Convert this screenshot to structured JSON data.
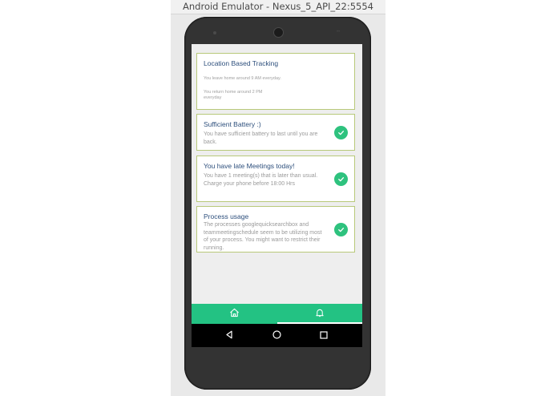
{
  "window": {
    "title": "Android Emulator - Nexus_5_API_22:5554"
  },
  "cards": [
    {
      "title": "Location Based Tracking",
      "lines": [
        "You leave home around 9 AM everyday.",
        "You return home around 2 PM everyday"
      ],
      "checked": false
    },
    {
      "title": "Sufficient Battery :)",
      "text": "You have sufficient battery to last until you are back.",
      "checked": true
    },
    {
      "title": "You have late Meetings today!",
      "text": "You have 1 meeting(s) that is later than usual. Charge your phone before 18:00 Hrs",
      "checked": true
    },
    {
      "title": "Process usage",
      "text": "The processes googlequicksearchbox and teammeetingschedule seem to be utilizing most of your process. You might want to restrict their running.",
      "checked": true
    }
  ],
  "bottom_nav": {
    "tabs": [
      {
        "icon": "home-icon",
        "selected": false
      },
      {
        "icon": "bell-icon",
        "selected": true
      }
    ]
  },
  "system_nav": [
    "back-icon",
    "home-circle-icon",
    "recents-icon"
  ],
  "colors": {
    "accent_green": "#23c283",
    "card_border": "#b8c97a",
    "title_blue": "#2d4f7c",
    "body_gray": "#9a9a9a"
  }
}
